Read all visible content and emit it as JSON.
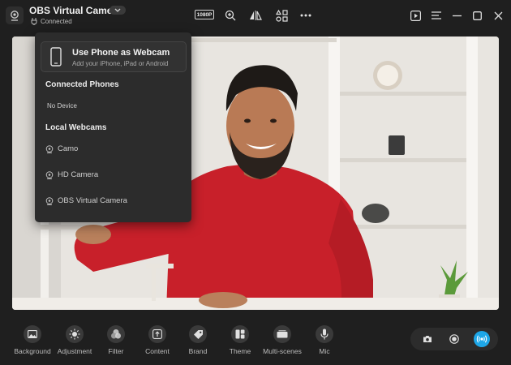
{
  "app": {
    "title": "OBS Virtual Camera",
    "status": "Connected",
    "resolution_badge": "1080P"
  },
  "menu": {
    "phone_card": {
      "title": "Use Phone as Webcam",
      "subtitle": "Add your iPhone, iPad or Android"
    },
    "connected_phones_heading": "Connected Phones",
    "no_device": "No Device",
    "local_webcams_heading": "Local Webcams",
    "webcams": [
      "Camo",
      "HD Camera",
      "OBS Virtual Camera"
    ]
  },
  "toolbar": {
    "items": [
      {
        "label": "Background",
        "icon": "image-icon"
      },
      {
        "label": "Adjustment",
        "icon": "sun-icon"
      },
      {
        "label": "Filter",
        "icon": "filter-icon"
      },
      {
        "label": "Content",
        "icon": "upload-icon"
      },
      {
        "label": "Brand",
        "icon": "tag-icon"
      },
      {
        "label": "Theme",
        "icon": "theme-icon"
      },
      {
        "label": "Multi-scenes",
        "icon": "scenes-icon"
      },
      {
        "label": "Mic",
        "icon": "mic-icon"
      }
    ]
  },
  "colors": {
    "accent": "#1ea7e8",
    "background": "#1f1f1f",
    "menu_bg": "#2c2c2c",
    "sweater": "#c8202a"
  }
}
